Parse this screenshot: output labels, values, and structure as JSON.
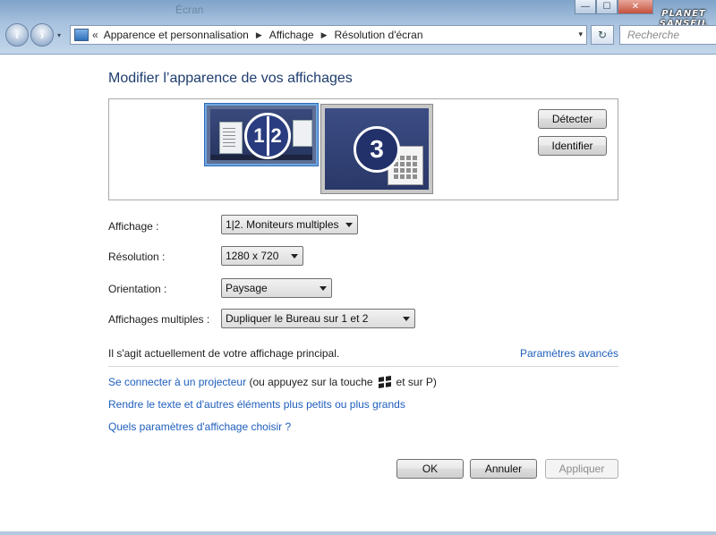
{
  "window": {
    "ghost_title": "Écran",
    "controls": {
      "minimize": "—",
      "maximize": "☐",
      "close": "✕"
    }
  },
  "logo": {
    "line1": "PLANET",
    "line2": "SANSFIL"
  },
  "nav": {
    "back": "‹",
    "forward": "›",
    "history": "▾"
  },
  "address": {
    "chevron": "«",
    "crumbs": [
      "Apparence et personnalisation",
      "Affichage",
      "Résolution d'écran"
    ],
    "separator": "▶",
    "dropdown": "▾"
  },
  "refresh_glyph": "↻",
  "search": {
    "placeholder": "Recherche"
  },
  "main": {
    "title": "Modifier l’apparence de vos affichages",
    "monitors": {
      "group_a": [
        "1",
        "2"
      ],
      "group_b": "3"
    },
    "detect_button": "Détecter",
    "identify_button": "Identifier",
    "fields": {
      "display": {
        "label": "Affichage :",
        "value": "1|2. Moniteurs multiples"
      },
      "resolution": {
        "label": "Résolution :",
        "value": "1280 x 720"
      },
      "orientation": {
        "label": "Orientation :",
        "value": "Paysage"
      },
      "multiple": {
        "label": "Affichages multiples :",
        "value": "Dupliquer le Bureau sur 1 et 2"
      }
    },
    "info_text": "Il s'agit actuellement de votre affichage principal.",
    "advanced_link": "Paramètres avancés",
    "projector_link": "Se connecter à un projecteur",
    "projector_text_a": "(ou appuyez sur la touche",
    "projector_text_b": "et sur P)",
    "text_size_link": "Rendre le texte et d'autres éléments plus petits ou plus grands",
    "which_settings_link": "Quels paramètres d'affichage choisir ?"
  },
  "footer": {
    "ok": "OK",
    "cancel": "Annuler",
    "apply": "Appliquer"
  },
  "colors": {
    "link": "#1e5ebc",
    "heading": "#1e3d6e",
    "selection": "#6fa7e0"
  }
}
